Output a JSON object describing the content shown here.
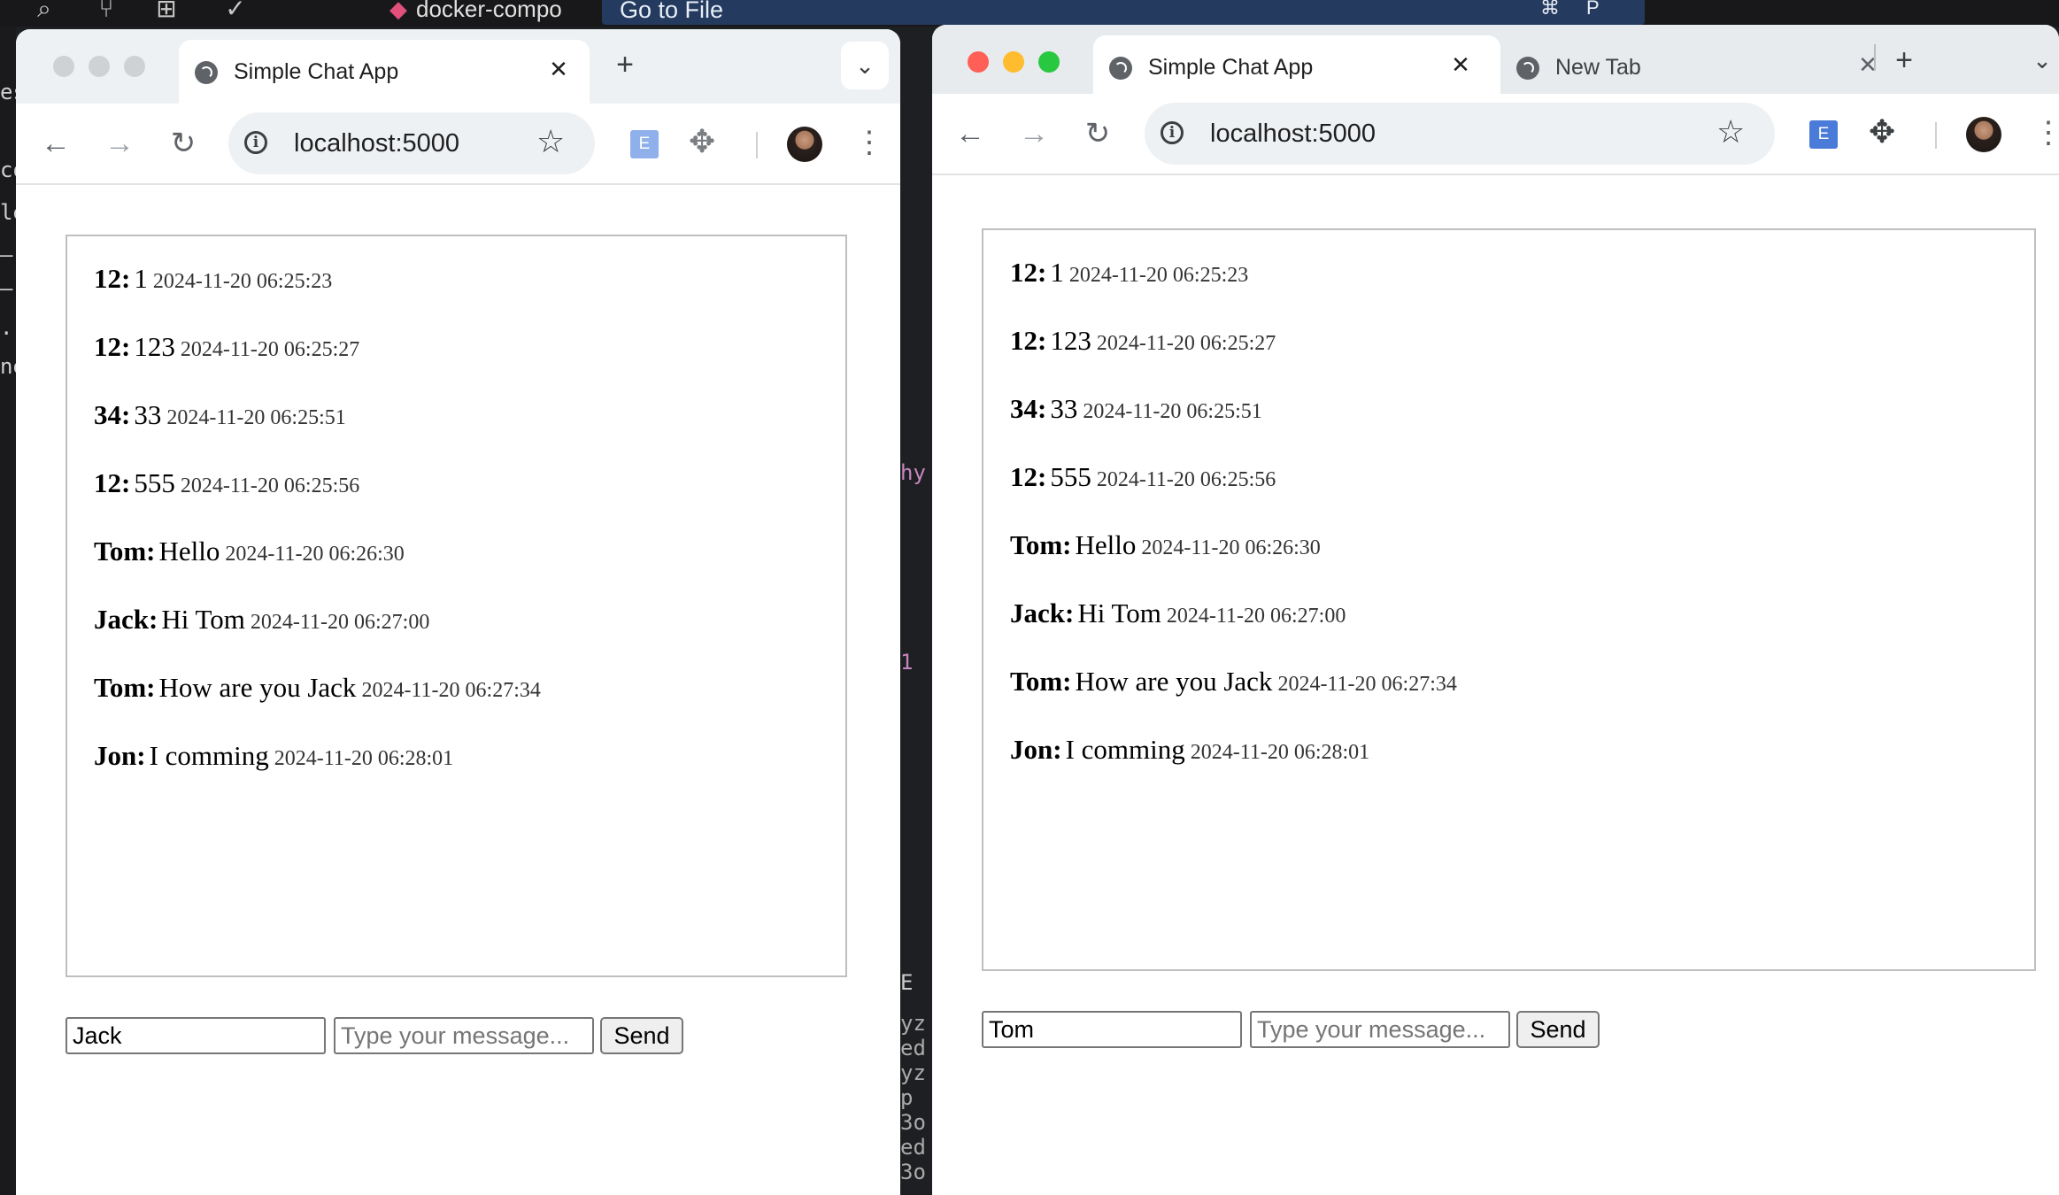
{
  "editor": {
    "docker_tab": "docker-compo",
    "goto_label": "Go to File",
    "shortcut_keys": [
      "⌘",
      "P"
    ],
    "left_strip_chars": [
      "es",
      "co",
      "le",
      "—",
      "—",
      ".r",
      "ne"
    ],
    "mid_strip_chars": [
      "hy",
      "1",
      "E",
      "yz",
      "ed",
      "yz",
      "p",
      "3o",
      "ed",
      "3o"
    ]
  },
  "left_window": {
    "tabs": [
      {
        "title": "Simple Chat App",
        "close": "✕"
      }
    ],
    "new_tab": "+",
    "tab_menu": "⌄",
    "url": "localhost:5000",
    "extension_label": "E",
    "messages": [
      {
        "user": "12:",
        "text": "1",
        "time": "2024-11-20 06:25:23"
      },
      {
        "user": "12:",
        "text": "123",
        "time": "2024-11-20 06:25:27"
      },
      {
        "user": "34:",
        "text": "33",
        "time": "2024-11-20 06:25:51"
      },
      {
        "user": "12:",
        "text": "555",
        "time": "2024-11-20 06:25:56"
      },
      {
        "user": "Tom:",
        "text": "Hello",
        "time": "2024-11-20 06:26:30"
      },
      {
        "user": "Jack:",
        "text": "Hi Tom",
        "time": "2024-11-20 06:27:00"
      },
      {
        "user": "Tom:",
        "text": "How are you Jack",
        "time": "2024-11-20 06:27:34"
      },
      {
        "user": "Jon:",
        "text": "I comming",
        "time": "2024-11-20 06:28:01"
      }
    ],
    "name_value": "Jack",
    "message_placeholder": "Type your message...",
    "send_label": "Send"
  },
  "right_window": {
    "tabs": [
      {
        "title": "Simple Chat App",
        "close": "✕"
      },
      {
        "title": "New Tab",
        "close": "✕"
      }
    ],
    "new_tab": "+",
    "tab_menu": "⌄",
    "url": "localhost:5000",
    "extension_label": "E",
    "messages": [
      {
        "user": "12:",
        "text": "1",
        "time": "2024-11-20 06:25:23"
      },
      {
        "user": "12:",
        "text": "123",
        "time": "2024-11-20 06:25:27"
      },
      {
        "user": "34:",
        "text": "33",
        "time": "2024-11-20 06:25:51"
      },
      {
        "user": "12:",
        "text": "555",
        "time": "2024-11-20 06:25:56"
      },
      {
        "user": "Tom:",
        "text": "Hello",
        "time": "2024-11-20 06:26:30"
      },
      {
        "user": "Jack:",
        "text": "Hi Tom",
        "time": "2024-11-20 06:27:00"
      },
      {
        "user": "Tom:",
        "text": "How are you Jack",
        "time": "2024-11-20 06:27:34"
      },
      {
        "user": "Jon:",
        "text": "I comming",
        "time": "2024-11-20 06:28:01"
      }
    ],
    "name_value": "Tom",
    "message_placeholder": "Type your message...",
    "send_label": "Send"
  }
}
